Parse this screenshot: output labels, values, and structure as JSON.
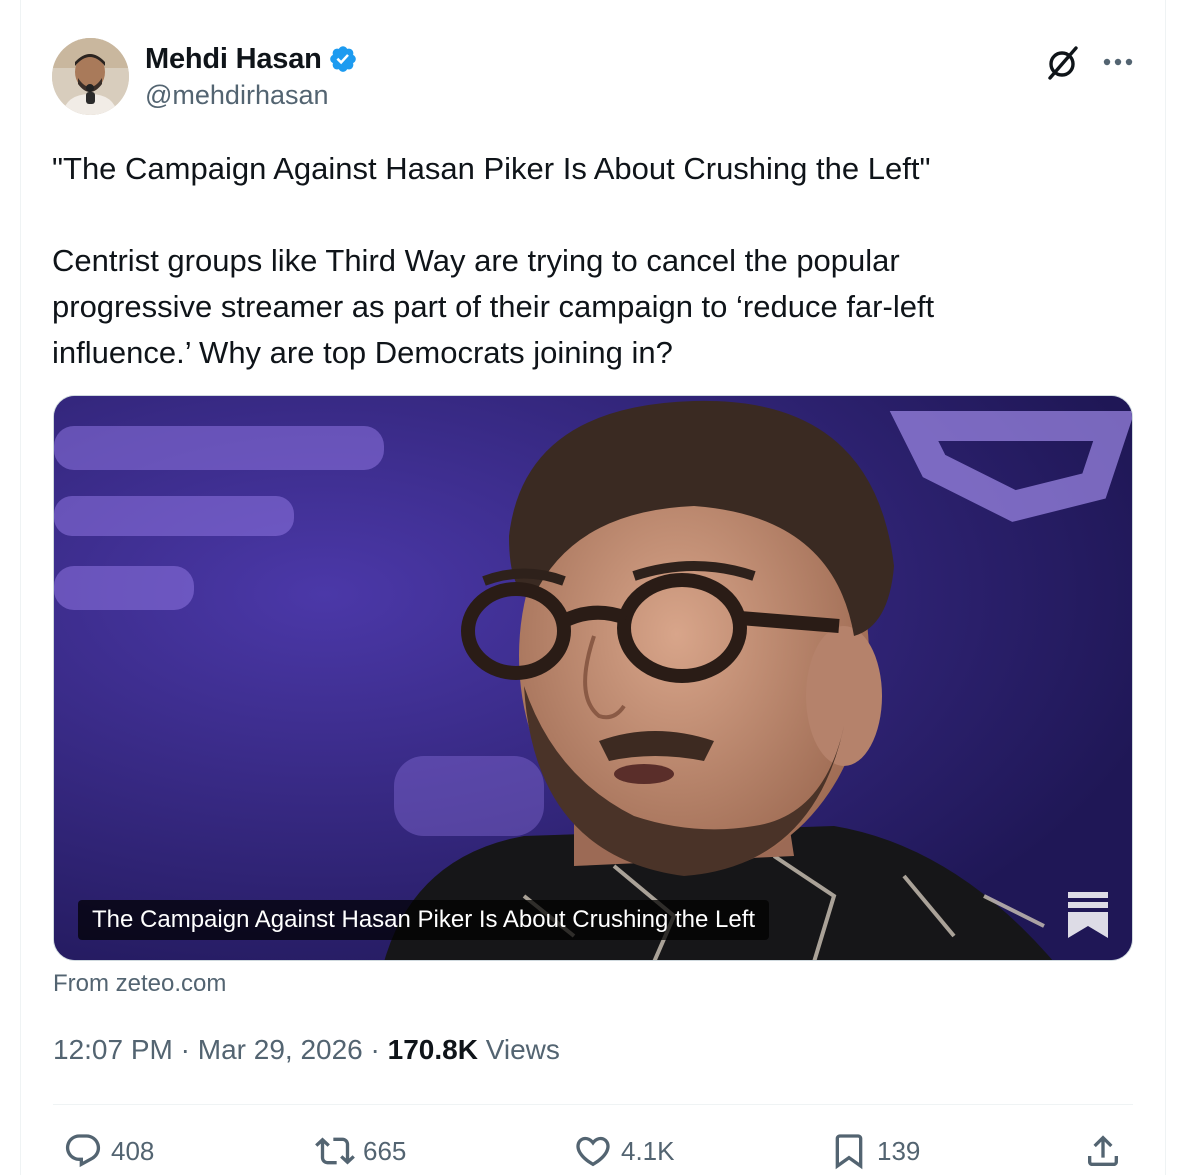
{
  "author": {
    "display_name": "Mehdi Hasan",
    "handle": "@mehdirhasan",
    "verified": true,
    "verified_color": "#1d9bf0"
  },
  "tweet": {
    "quote_line": "\"The Campaign Against Hasan Piker Is About Crushing the Left\"",
    "body_line": "Centrist groups like Third Way are trying to cancel the popular progressive streamer as part of their campaign to ‘reduce far-left influence.’ Why are top Democrats joining in?"
  },
  "card": {
    "caption": "The Campaign Against Hasan Piker Is About Crushing the Left",
    "source": "From zeteo.com",
    "background_color": "#2a1f6b"
  },
  "meta": {
    "time": "12:07 PM",
    "separator": " · ",
    "date": "Mar 29, 2026",
    "views_count": "170.8K",
    "views_label": "Views"
  },
  "actions": {
    "replies": "408",
    "retweets": "665",
    "likes": "4.1K",
    "bookmarks": "139"
  },
  "icons": {
    "header": [
      "grok-icon",
      "more-icon"
    ],
    "actions": [
      "reply-icon",
      "retweet-icon",
      "like-icon",
      "bookmark-icon",
      "share-icon"
    ]
  }
}
